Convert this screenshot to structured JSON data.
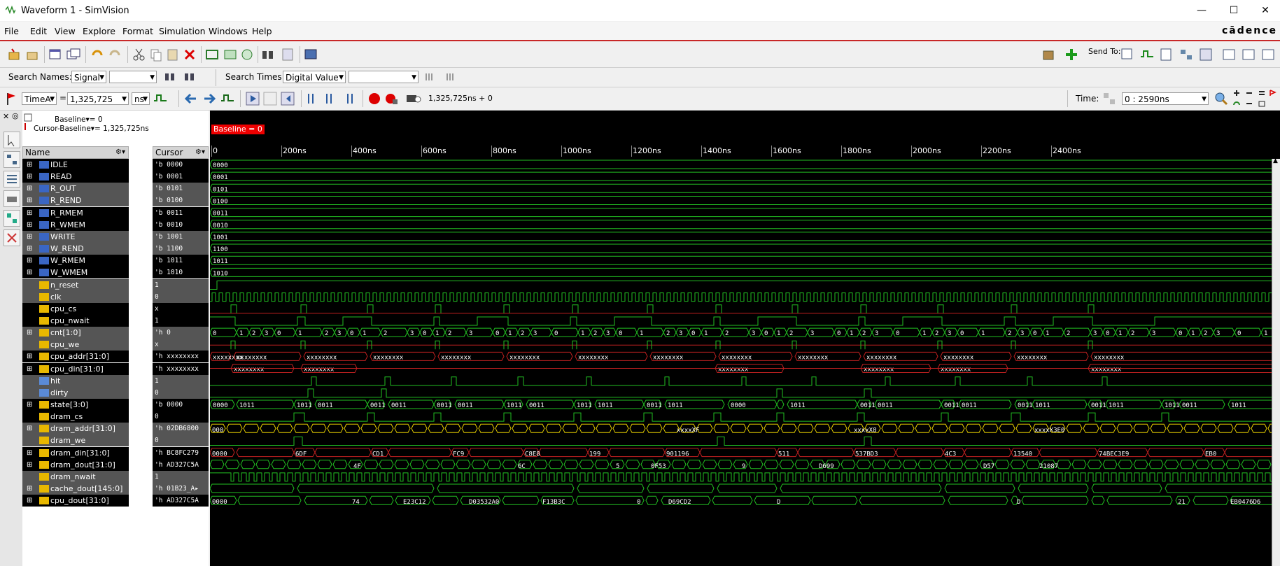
{
  "window": {
    "title": "Waveform 1 - SimVision"
  },
  "menu": [
    "File",
    "Edit",
    "View",
    "Explore",
    "Format",
    "Simulation",
    "Windows",
    "Help"
  ],
  "brand": "cādence",
  "search": {
    "names_label": "Search Names:",
    "names_type": "Signal",
    "times_label": "Search Times:",
    "times_type": "Digital Value"
  },
  "send_to_label": "Send To:",
  "cursor_bar": {
    "cursor_name": "TimeA",
    "eq": "=",
    "cursor_value": "1,325,725",
    "unit": "ns",
    "sim_time": "1,325,725ns + 0",
    "time_label": "Time:",
    "time_range": "0 : 2590ns"
  },
  "baseline_info": {
    "baseline": "Baseline▾= 0",
    "cursor_baseline": "Cursor-Baseline▾= 1,325,725ns"
  },
  "columns": {
    "name": "Name",
    "cursor": "Cursor"
  },
  "baseline_tag": "Baseline = 0",
  "ruler": [
    "0",
    "200ns",
    "400ns",
    "600ns",
    "800ns",
    "1000ns",
    "1200ns",
    "1400ns",
    "1600ns",
    "1800ns",
    "2000ns",
    "2200ns",
    "2400ns"
  ],
  "signals": [
    {
      "name": "IDLE",
      "cursor": "'b 0000",
      "kind": "param",
      "wave": "0000"
    },
    {
      "name": "READ",
      "cursor": "'b 0001",
      "kind": "param",
      "wave": "0001"
    },
    {
      "name": "R_OUT",
      "cursor": "'b 0101",
      "kind": "param",
      "wave": "0101"
    },
    {
      "name": "R_REND",
      "cursor": "'b 0100",
      "kind": "param",
      "wave": "0100"
    },
    {
      "name": "R_RMEM",
      "cursor": "'b 0011",
      "kind": "param",
      "wave": "0011"
    },
    {
      "name": "R_WMEM",
      "cursor": "'b 0010",
      "kind": "param",
      "wave": "0010"
    },
    {
      "name": "WRITE",
      "cursor": "'b 1001",
      "kind": "param",
      "wave": "1001"
    },
    {
      "name": "W_REND",
      "cursor": "'b 1100",
      "kind": "param",
      "wave": "1100"
    },
    {
      "name": "W_RMEM",
      "cursor": "'b 1011",
      "kind": "param",
      "wave": "1011"
    },
    {
      "name": "W_WMEM",
      "cursor": "'b 1010",
      "kind": "param",
      "wave": "1010"
    },
    {
      "name": "n_reset",
      "cursor": "1",
      "kind": "in"
    },
    {
      "name": "clk",
      "cursor": "0",
      "kind": "in"
    },
    {
      "name": "cpu_cs",
      "cursor": "x",
      "kind": "in"
    },
    {
      "name": "cpu_nwait",
      "cursor": "1",
      "kind": "out"
    },
    {
      "name": "cnt[1:0]",
      "cursor": "'h 0",
      "kind": "bus"
    },
    {
      "name": "cpu_we",
      "cursor": "x",
      "kind": "in"
    },
    {
      "name": "cpu_addr[31:0]",
      "cursor": "'h xxxxxxxx",
      "kind": "bus"
    },
    {
      "name": "cpu_din[31:0]",
      "cursor": "'h xxxxxxxx",
      "kind": "bus"
    },
    {
      "name": "hit",
      "cursor": "1",
      "kind": "reg"
    },
    {
      "name": "dirty",
      "cursor": "0",
      "kind": "reg"
    },
    {
      "name": "state[3:0]",
      "cursor": "'b 0000",
      "kind": "bus"
    },
    {
      "name": "dram_cs",
      "cursor": "0",
      "kind": "out"
    },
    {
      "name": "dram_addr[31:0]",
      "cursor": "'h 02DB6800",
      "kind": "bus"
    },
    {
      "name": "dram_we",
      "cursor": "0",
      "kind": "out"
    },
    {
      "name": "dram_din[31:0]",
      "cursor": "'h BC8FC279",
      "kind": "bus"
    },
    {
      "name": "dram_dout[31:0]",
      "cursor": "'h AD327C5A",
      "kind": "bus"
    },
    {
      "name": "dram_nwait",
      "cursor": "1",
      "kind": "in"
    },
    {
      "name": "cache_dout[145:0]",
      "cursor": "'h 01B23_A▸",
      "kind": "bus"
    },
    {
      "name": "cpu_dout[31:0]",
      "cursor": "'h AD327C5A",
      "kind": "bus"
    }
  ],
  "bus_waves": {
    "cnt": [
      "0",
      "1",
      "2",
      "3",
      "0",
      "1",
      "2",
      "3",
      "0",
      "1",
      "2",
      "3",
      "0",
      "1",
      "2",
      "3",
      "0",
      "1",
      "2",
      "3",
      "0",
      "1",
      "2",
      "3",
      "0",
      "1",
      "2",
      "3",
      "0",
      "1",
      "2",
      "3",
      "0",
      "1",
      "2",
      "3",
      "0",
      "1",
      "2",
      "3",
      "0",
      "1",
      "2",
      "3",
      "0",
      "1",
      "2",
      "3",
      "0",
      "1",
      "2",
      "3"
    ],
    "cpu_addr": [
      "xxxxxxxx",
      "xxxxxxxx",
      "xxxxxxxx",
      "xxxxxxxx",
      "xxxxxxxx",
      "xxxxxxxx",
      "xxxxxxxx",
      "xxxxxxxx",
      "xxxxxxxx",
      "xxxxxxxx",
      "xxxxxxxx",
      "xxxxxxxx",
      "xxxxxxxx"
    ],
    "cpu_din": [
      "xxxxxxxx",
      "xxxxxxxx",
      "xxxxxxxx",
      "xxxxxxxx",
      "xxxxxxxx",
      "xxxxxxxx"
    ],
    "state": [
      "0000",
      "1011",
      "1011",
      "0011",
      "0011",
      "0011",
      "0011",
      "0011",
      "1011",
      "0011",
      "1011",
      "1011",
      "0011",
      "1011"
    ],
    "dram_din": [
      "0000",
      "6DF",
      "CD1",
      "FC9",
      "C8E8",
      "199",
      "901196",
      "511",
      "537BD3",
      "4C3",
      "13540",
      "74BEC3E9",
      "EB0"
    ],
    "dram_dout": [
      "4F",
      "6C",
      "5",
      "0F53",
      "9",
      "D699",
      "D57",
      "21087"
    ],
    "cpu_dout": [
      "0000",
      "74",
      "E23C12",
      "D03532A0",
      "F13B3C",
      "0",
      "D69CD2",
      "D",
      "D",
      "21",
      "EB0476D6"
    ],
    "dram_addr": [
      "000",
      "xxxxXF",
      "xxxxX8",
      "xxxxX3E0"
    ]
  }
}
